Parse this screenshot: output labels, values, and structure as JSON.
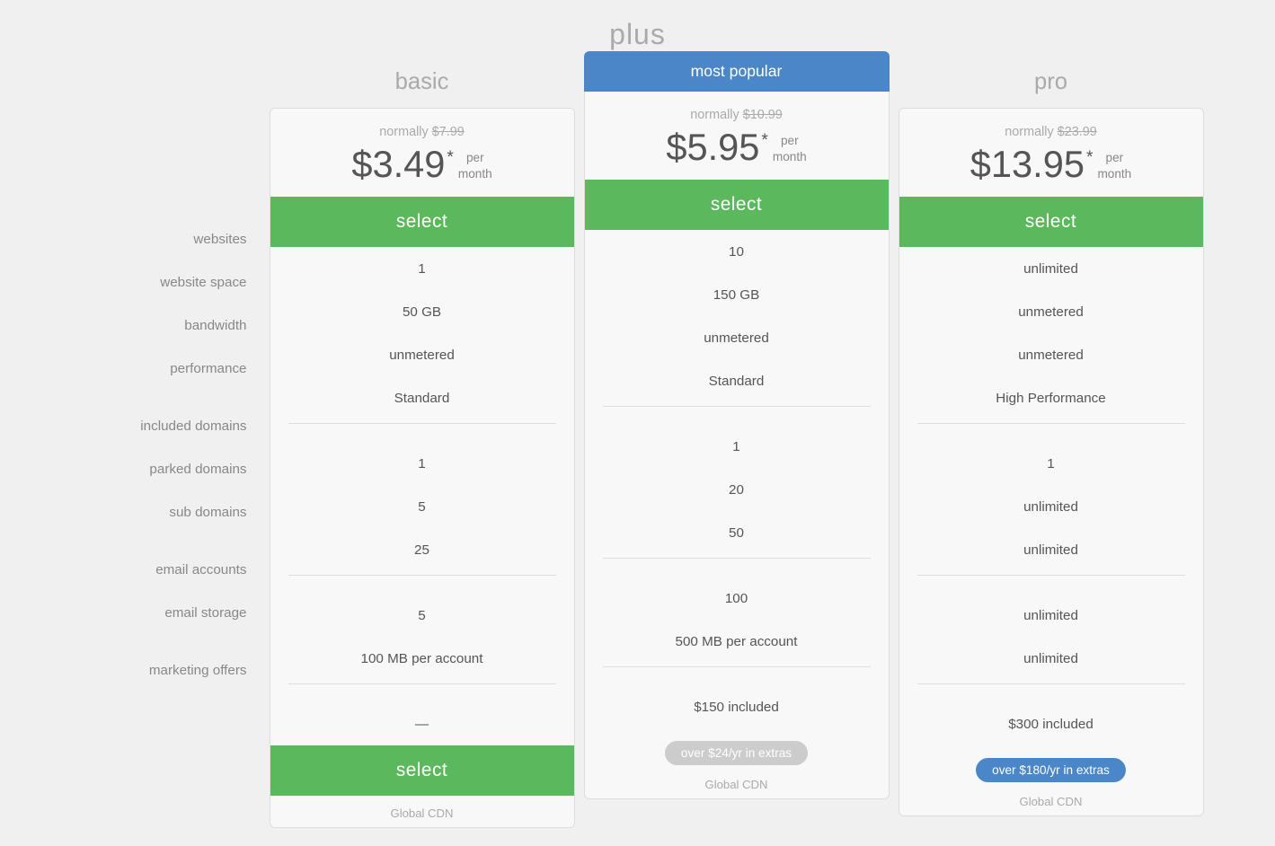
{
  "page": {
    "group_title": "plus",
    "plans": [
      {
        "id": "basic",
        "name": "basic",
        "popular": false,
        "popular_label": "",
        "normally_label": "normally",
        "normally_price": "$7.99",
        "price": "$3.49",
        "asterisk": "*",
        "per_label": "per\nmonth",
        "select_label": "select",
        "features": {
          "websites": "1",
          "website_space": "50 GB",
          "bandwidth": "unmetered",
          "performance": "Standard",
          "included_domains": "1",
          "parked_domains": "5",
          "sub_domains": "25",
          "email_accounts": "5",
          "email_storage": "100 MB per account",
          "marketing_offers": "—"
        },
        "extras_badge": null,
        "bottom_label": "Global CDN"
      },
      {
        "id": "plus",
        "name": "most popular",
        "popular": true,
        "popular_label": "most popular",
        "normally_label": "normally",
        "normally_price": "$10.99",
        "price": "$5.95",
        "asterisk": "*",
        "per_label": "per\nmonth",
        "select_label": "select",
        "features": {
          "websites": "10",
          "website_space": "150 GB",
          "bandwidth": "unmetered",
          "performance": "Standard",
          "included_domains": "1",
          "parked_domains": "20",
          "sub_domains": "50",
          "email_accounts": "100",
          "email_storage": "500 MB per account",
          "marketing_offers": "$150 included"
        },
        "extras_badge": "over $24/yr in extras",
        "bottom_label": "Global CDN"
      },
      {
        "id": "pro",
        "name": "pro",
        "popular": false,
        "popular_label": "",
        "normally_label": "normally",
        "normally_price": "$23.99",
        "price": "$13.95",
        "asterisk": "*",
        "per_label": "per\nmonth",
        "select_label": "select",
        "features": {
          "websites": "unlimited",
          "website_space": "unmetered",
          "bandwidth": "unmetered",
          "performance": "High Performance",
          "included_domains": "1",
          "parked_domains": "unlimited",
          "sub_domains": "unlimited",
          "email_accounts": "unlimited",
          "email_storage": "unlimited",
          "marketing_offers": "$300 included"
        },
        "extras_badge": "over $180/yr in extras",
        "bottom_label": "Global CDN"
      }
    ],
    "feature_labels": [
      {
        "key": "websites",
        "label": "websites"
      },
      {
        "key": "website_space",
        "label": "website space"
      },
      {
        "key": "bandwidth",
        "label": "bandwidth"
      },
      {
        "key": "performance",
        "label": "performance"
      },
      {
        "key": "div1",
        "label": ""
      },
      {
        "key": "included_domains",
        "label": "included domains"
      },
      {
        "key": "parked_domains",
        "label": "parked domains"
      },
      {
        "key": "sub_domains",
        "label": "sub domains"
      },
      {
        "key": "div2",
        "label": ""
      },
      {
        "key": "email_accounts",
        "label": "email accounts"
      },
      {
        "key": "email_storage",
        "label": "email storage"
      },
      {
        "key": "div3",
        "label": ""
      },
      {
        "key": "marketing_offers",
        "label": "marketing offers"
      }
    ]
  }
}
